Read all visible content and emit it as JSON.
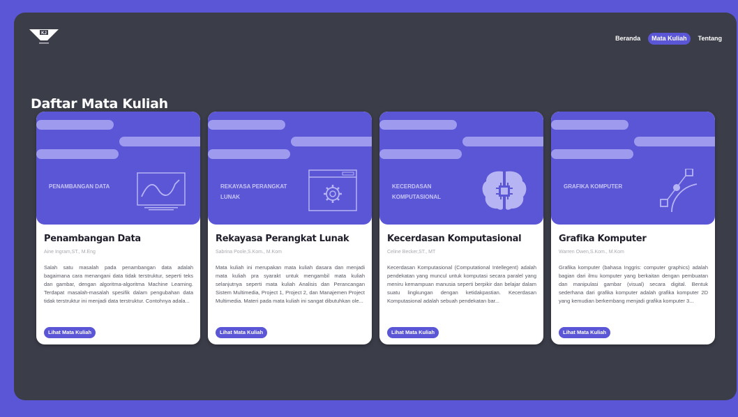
{
  "header": {
    "logo_icon": "kj-logo-icon",
    "nav": [
      {
        "label": "Beranda",
        "active": false
      },
      {
        "label": "Mata Kuliah",
        "active": true
      },
      {
        "label": "Tentang",
        "active": false
      }
    ]
  },
  "page": {
    "title": "Daftar Mata Kuliah"
  },
  "colors": {
    "accent": "#5b56d6",
    "background": "#3b3d49",
    "banner_bar": "#9e9bee"
  },
  "courses": [
    {
      "banner_label": "PENAMBANGAN DATA",
      "banner_icon": "line-chart-icon",
      "title": "Penambangan Data",
      "author": "Aine Ingram,ST., M.Eng",
      "description": "Salah satu masalah pada penambangan data adalah bagaimana cara menangani data tidak terstruktur, seperti teks dan gambar, dengan algoritma-algoritma Machine Learning. Terdapat masalah-masalah spesifik dalam pengubahan data tidak terstruktur ini menjadi data terstruktur. Contohnya adala...",
      "button": "Lihat Mata Kuliah"
    },
    {
      "banner_label": "REKAYASA PERANGKAT LUNAK",
      "banner_icon": "browser-gear-icon",
      "title": "Rekayasa Perangkat Lunak",
      "author": "Sabrina Poole,S.Kom., M.Kom",
      "description": "Mata kuliah ini merupakan mata kuliah dasara dan menjadi mata kuliah pra syarakt untuk mengambil mata kuliah selanjutnya seperti mata kuliah Analisis dan Perancangan Sistem Multimedia, Project 1, Project 2, dan Manajemen Project Multimedia. Materi pada mata kuliah ini sangat dibutuhkan ole...",
      "button": "Lihat Mata Kuliah"
    },
    {
      "banner_label": "KECERDASAN KOMPUTASIONAL",
      "banner_icon": "brain-chip-icon",
      "title": "Kecerdasan Komputasional",
      "author": "Celine Becker,ST., MT",
      "description": "Kecerdasan Komputasional (Computational Intellegent) adalah pendekatan yang muncul untuk komputasi secara paralel yang meniru kemampuan manusia seperti berpikir dan belajar dalam suatu lingkungan dengan ketidakpastian. Kecerdasan Komputasional adalah sebuah pendekatan bar...",
      "button": "Lihat Mata Kuliah"
    },
    {
      "banner_label": "GRAFIKA KOMPUTER",
      "banner_icon": "bezier-curve-icon",
      "title": "Grafika Komputer",
      "author": "Warren Owen,S.Kom., M.Kom",
      "description": "Grafika komputer (bahasa Inggris: computer graphics) adalah bagian dari ilmu komputer yang berkaitan dengan pembuatan dan manipulasi gambar (visual) secara digital. Bentuk sederhana dari grafika komputer adalah grafika komputer 2D yang kemudian berkembang menjadi grafika komputer 3...",
      "button": "Lihat Mata Kuliah"
    }
  ]
}
